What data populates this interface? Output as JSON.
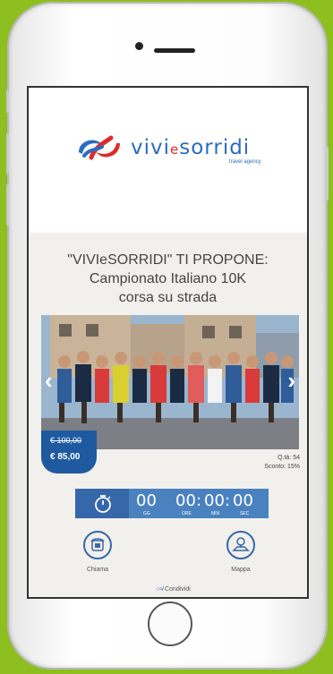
{
  "header": {
    "logo_text": "vivi",
    "logo_e": "e",
    "logo_text2": "sorridi",
    "logo_subtitle": "travel agency"
  },
  "promo": {
    "title_line1": "\"VIVIeSORRIDI\" TI PROPONE:",
    "title_line2": "Campionato Italiano 10K",
    "title_line3": "corsa su strada"
  },
  "slider": {
    "left_arrow": "‹",
    "right_arrow": "›",
    "image": "runners-race-photo"
  },
  "price": {
    "old": "€ 100,00",
    "new": "€ 85,00"
  },
  "info": {
    "quantity": "Q.tà: 54",
    "discount": "Sconto: 15%"
  },
  "countdown": {
    "days": "00",
    "hours": "00",
    "minutes": "00",
    "seconds": "00",
    "sep1": ":",
    "sep2": ":",
    "days_label": "GG",
    "hours_label": "ORE",
    "minutes_label": "MIN",
    "seconds_label": "SEC"
  },
  "actions": {
    "call_label": "Chiama",
    "map_label": "Mappa",
    "share_label": "Condividi"
  },
  "colors": {
    "background": "#8cbf1f",
    "brand_blue": "#2a6cc0",
    "brand_red": "#e02b2b",
    "badge": "#1f5aa0",
    "countdown": "#4a82c0"
  }
}
